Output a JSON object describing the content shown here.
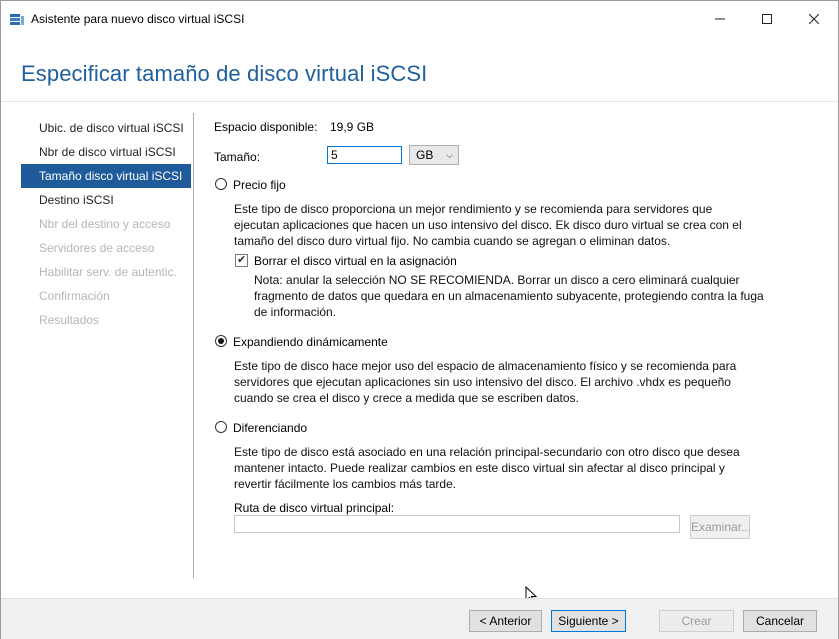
{
  "window": {
    "title": "Asistente para nuevo disco virtual iSCSI",
    "controls": {
      "minimize": "—",
      "maximize": "☐",
      "close": "✕"
    }
  },
  "header": {
    "title": "Especificar tamaño de disco virtual iSCSI"
  },
  "nav": {
    "items": [
      {
        "label": "Ubic. de disco virtual iSCSI",
        "state": "normal"
      },
      {
        "label": "Nbr de disco virtual iSCSI",
        "state": "normal"
      },
      {
        "label": "Tamaño disco virtual iSCSI",
        "state": "selected"
      },
      {
        "label": "Destino iSCSI",
        "state": "normal"
      },
      {
        "label": "Nbr del destino y acceso",
        "state": "disabled"
      },
      {
        "label": "Servidores de acceso",
        "state": "disabled"
      },
      {
        "label": "Habilitar serv. de autentic.",
        "state": "disabled"
      },
      {
        "label": "Confirmación",
        "state": "disabled"
      },
      {
        "label": "Resultados",
        "state": "disabled"
      }
    ]
  },
  "form": {
    "available_label": "Espacio disponible:",
    "available_value": "19,9 GB",
    "size_label": "Tamaño:",
    "size_value": "5",
    "size_unit": "GB",
    "fixed": {
      "label": "Precio fijo",
      "selected": false,
      "description": "Este tipo de disco proporciona un mejor rendimiento y se recomienda para servidores que ejecutan aplicaciones que hacen un uso intensivo del disco. Ek disco duro virtual se crea con el tamaño del disco duro virtual fijo. No cambia cuando se agregan o eliminan datos.",
      "erase_label": "Borrar el disco virtual en la asignación",
      "erase_checked": true,
      "erase_note": "Nota: anular la selección NO SE RECOMIENDA. Borrar un disco a cero eliminará cualquier fragmento de datos que quedara en un almacenamiento subyacente, protegiendo contra la fuga de información."
    },
    "dynamic": {
      "label": "Expandiendo dinámicamente",
      "selected": true,
      "description": "Este tipo de disco hace mejor uso del espacio de almacenamiento físico y se recomienda para servidores que ejecutan aplicaciones sin uso intensivo del disco. El archivo .vhdx es pequeño cuando se crea el disco y crece a medida que se escriben datos."
    },
    "differencing": {
      "label": "Diferenciando",
      "selected": false,
      "description": "Este tipo de disco está asociado en una relación principal-secundario con otro disco que desea mantener intacto. Puede realizar cambios en este disco virtual sin afectar al disco principal y revertir fácilmente los cambios más tarde.",
      "parent_path_label": "Ruta de disco virtual principal:",
      "parent_path_value": "",
      "browse_label": "Examinar..."
    }
  },
  "footer": {
    "previous": "< Anterior",
    "next": "Siguiente >",
    "create": "Crear",
    "cancel": "Cancelar"
  }
}
